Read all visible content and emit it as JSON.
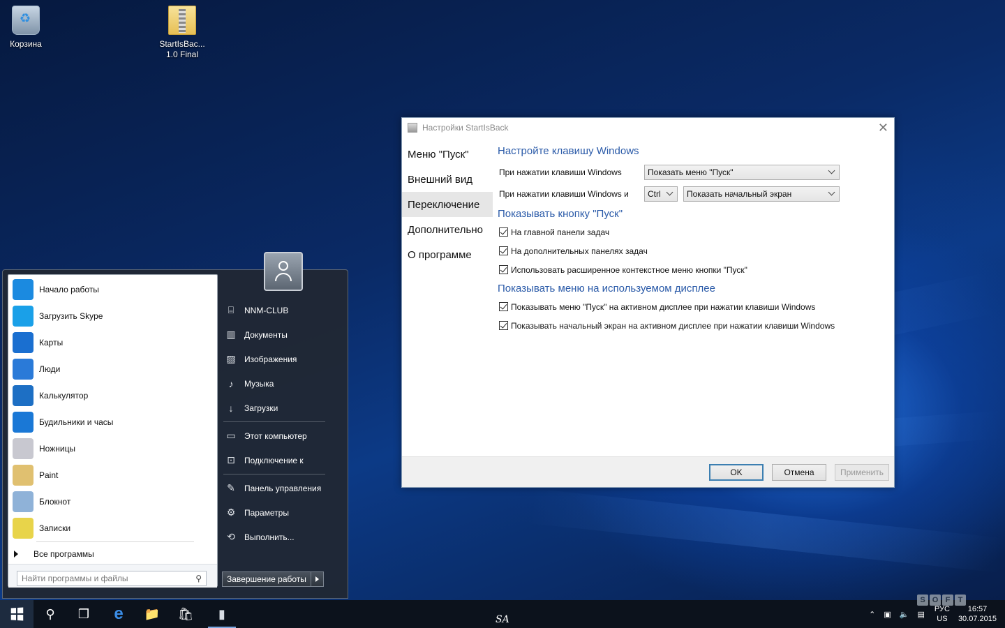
{
  "desktop": {
    "icons": [
      {
        "label": "Корзина",
        "icon": "recycle-bin-icon"
      },
      {
        "label": "StartIsBac...\n1.0 Final",
        "label_line1": "StartIsBac...",
        "label_line2": "1.0 Final",
        "icon": "archive-icon"
      }
    ]
  },
  "start_menu": {
    "programs": [
      {
        "label": "Начало работы",
        "icon": "lightbulb-icon",
        "color": "#1b8ae0"
      },
      {
        "label": "Загрузить Skype",
        "icon": "skype-icon",
        "color": "#1aa0e8"
      },
      {
        "label": "Карты",
        "icon": "maps-icon",
        "color": "#1a6fd0"
      },
      {
        "label": "Люди",
        "icon": "people-icon",
        "color": "#2a7ad8"
      },
      {
        "label": "Калькулятор",
        "icon": "calculator-icon",
        "color": "#1d6fc4"
      },
      {
        "label": "Будильники и часы",
        "icon": "alarm-clock-icon",
        "color": "#1a78d6"
      },
      {
        "label": "Ножницы",
        "icon": "scissors-icon",
        "color": "#c8c8d0"
      },
      {
        "label": "Paint",
        "icon": "paint-icon",
        "color": "#e0c070"
      },
      {
        "label": "Блокнот",
        "icon": "notepad-icon",
        "color": "#8fb2d8"
      },
      {
        "label": "Записки",
        "icon": "sticky-notes-icon",
        "color": "#e8d44a"
      }
    ],
    "all_programs": "Все программы",
    "search_placeholder": "Найти программы и файлы",
    "right_items": [
      {
        "label": "NNM-CLUB",
        "icon": "user-folder-icon"
      },
      {
        "label": "Документы",
        "icon": "documents-icon"
      },
      {
        "label": "Изображения",
        "icon": "pictures-icon"
      },
      {
        "label": "Музыка",
        "icon": "music-icon"
      },
      {
        "label": "Загрузки",
        "icon": "downloads-icon"
      },
      {
        "label": "Этот компьютер",
        "icon": "computer-icon"
      },
      {
        "label": "Подключение к",
        "icon": "connect-icon"
      },
      {
        "label": "Панель управления",
        "icon": "control-panel-icon"
      },
      {
        "label": "Параметры",
        "icon": "settings-gear-icon"
      },
      {
        "label": "Выполнить...",
        "icon": "run-icon"
      }
    ],
    "shutdown": "Завершение работы"
  },
  "dialog": {
    "title": "Настройки StartIsBack",
    "nav": [
      {
        "label": "Меню \"Пуск\"",
        "active": false
      },
      {
        "label": "Внешний вид",
        "active": false
      },
      {
        "label": "Переключение",
        "active": true
      },
      {
        "label": "Дополнительно",
        "active": false
      },
      {
        "label": "О программе",
        "active": false
      }
    ],
    "section1_title": "Настройте клавишу Windows",
    "row1_label": "При нажатии клавиши Windows",
    "row1_value": "Показать меню \"Пуск\"",
    "row2_label": "При нажатии клавиши Windows и",
    "row2_modifier": "Ctrl",
    "row2_value": "Показать начальный экран",
    "section2_title": "Показывать кнопку \"Пуск\"",
    "section2_checks": [
      {
        "label": "На главной панели задач",
        "checked": true
      },
      {
        "label": "На дополнительных панелях задач",
        "checked": true
      },
      {
        "label": "Использовать расширенное контекстное меню кнопки \"Пуск\"",
        "checked": true
      }
    ],
    "section3_title": "Показывать меню на используемом дисплее",
    "section3_checks": [
      {
        "label": "Показывать меню \"Пуск\" на активном дисплее при нажатии клавиши Windows",
        "checked": true
      },
      {
        "label": "Показывать начальный экран на активном дисплее при нажатии клавиши Windows",
        "checked": true
      }
    ],
    "buttons": {
      "ok": "OK",
      "cancel": "Отмена",
      "apply": "Применить"
    }
  },
  "taskbar": {
    "center_text": "SA",
    "lang_line1": "РУС",
    "lang_line2": "US",
    "time": "16:57",
    "date": "30.07.2015",
    "badge": [
      "S",
      "O",
      "F",
      "T"
    ]
  }
}
